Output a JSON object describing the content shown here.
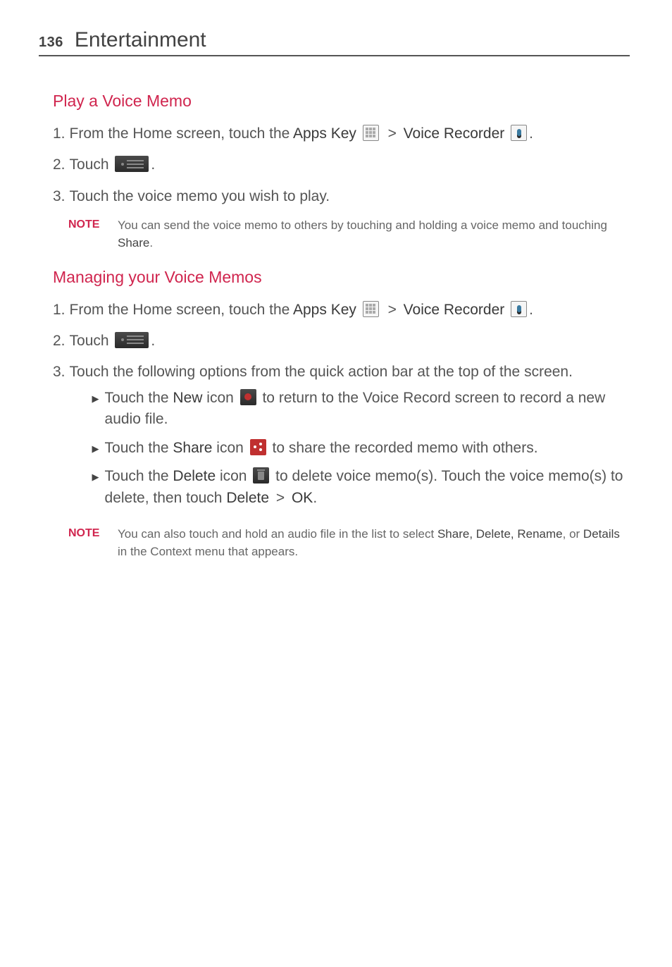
{
  "header": {
    "page_number": "136",
    "section": "Entertainment"
  },
  "play_section": {
    "heading": "Play a Voice Memo",
    "step1_prefix": "From the Home screen, touch the ",
    "step1_apps": "Apps Key",
    "step1_gt": " > ",
    "step1_recorder": "Voice Recorder",
    "step1_end": ".",
    "step2_prefix": "Touch ",
    "step2_end": ".",
    "step3": "Touch the voice memo you wish to play.",
    "note_label": "NOTE",
    "note_text_1": "You can send the voice memo to others by touching and holding a voice memo and touching ",
    "note_bold": "Share",
    "note_text_2": "."
  },
  "manage_section": {
    "heading": "Managing your Voice Memos",
    "step1_prefix": "From the Home screen, touch the ",
    "step1_apps": "Apps Key",
    "step1_gt": " > ",
    "step1_recorder": "Voice Recorder",
    "step1_end": ".",
    "step2_prefix": "Touch ",
    "step2_end": ".",
    "step3": "Touch the following options from the quick action bar at the top of the screen.",
    "bullet1_a": "Touch the ",
    "bullet1_bold": "New",
    "bullet1_b": " icon ",
    "bullet1_c": " to return to the Voice Record screen to record a new audio file.",
    "bullet2_a": "Touch the ",
    "bullet2_bold": "Share",
    "bullet2_b": " icon ",
    "bullet2_c": " to share the recorded memo with others.",
    "bullet3_a": "Touch the ",
    "bullet3_bold": "Delete",
    "bullet3_b": " icon ",
    "bullet3_c": " to delete voice memo(s). Touch the voice memo(s) to delete, then touch ",
    "bullet3_bold2": "Delete",
    "bullet3_gt": " > ",
    "bullet3_bold3": "OK",
    "bullet3_d": ".",
    "note_label": "NOTE",
    "note_text_1": "You can also touch and hold an audio file in the list to select ",
    "note_bold1": "Share, Delete, Rename",
    "note_text_2": ", or ",
    "note_bold2": "Details",
    "note_text_3": " in the Context menu that appears."
  }
}
